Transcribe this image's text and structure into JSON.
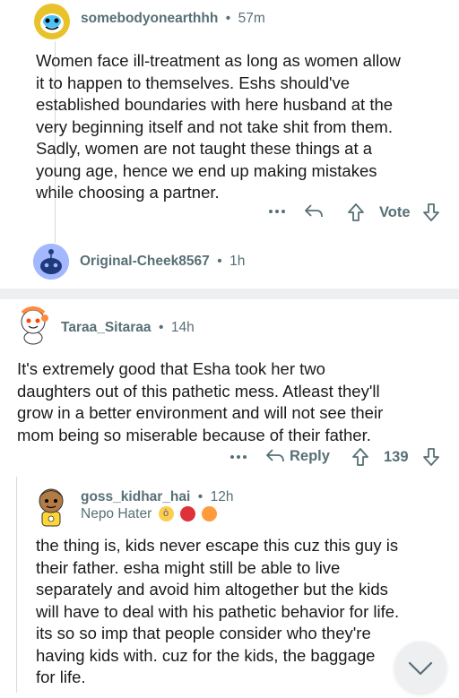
{
  "comments": [
    {
      "username": "somebodyonearthhh",
      "time": "57m",
      "text": [
        "Women face ill-treatment as long as women allow",
        "it to happen to themselves. Eshs should've",
        "established boundaries with here husband at the",
        "very beginning itself and not take shit from them.",
        "Sadly, women are not taught these things at a",
        "young age, hence we end up making mistakes",
        "while choosing a partner."
      ],
      "vote_label": "Vote"
    },
    {
      "username": "Original-Cheek8567",
      "time": "1h"
    },
    {
      "username": "Taraa_Sitaraa",
      "time": "14h",
      "text": [
        "It's extremely good that Esha took her two",
        "daughters out of this pathetic mess. Atleast they'll",
        "grow in a better environment and will not see their",
        "mom being so miserable because of their father."
      ],
      "reply_label": "Reply",
      "score": "139"
    },
    {
      "username": "goss_kidhar_hai",
      "time": "12h",
      "flair": "Nepo Hater",
      "text": [
        "the thing is, kids never escape this cuz this guy is",
        "their father. esha might still be able to live",
        "separately and avoid him altogether but the kids",
        "will have to deal with his pathetic behavior for life.",
        "its so so imp that people consider who they're",
        "having kids with. cuz for the kids, the baggage",
        "for life."
      ]
    }
  ],
  "separator_glyph": "•",
  "colors": {
    "meta": "#576f76",
    "text": "#1a1a1b",
    "separator": "#edeff1",
    "snoo_blue": "#7193ff"
  }
}
